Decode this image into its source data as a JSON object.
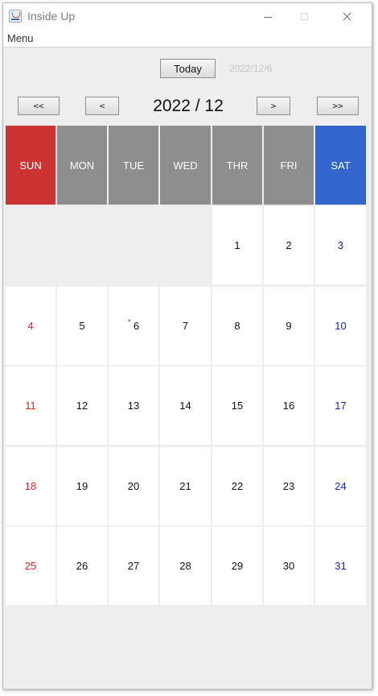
{
  "window": {
    "title": "Inside Up"
  },
  "menu": {
    "items": [
      "Menu"
    ]
  },
  "toolbar": {
    "today_label": "Today",
    "current_date": "2022/12/6"
  },
  "navigation": {
    "prev_year": "<<",
    "prev_month": "<",
    "month_label": "2022 / 12",
    "next_month": ">",
    "next_year": ">>"
  },
  "weekdays": [
    "SUN",
    "MON",
    "TUE",
    "WED",
    "THR",
    "FRI",
    "SAT"
  ],
  "calendar": {
    "weeks": [
      [
        "",
        "",
        "",
        "",
        "1",
        "2",
        "3"
      ],
      [
        "4",
        "5",
        "6",
        "7",
        "8",
        "9",
        "10"
      ],
      [
        "11",
        "12",
        "13",
        "14",
        "15",
        "16",
        "17"
      ],
      [
        "18",
        "19",
        "20",
        "21",
        "22",
        "23",
        "24"
      ],
      [
        "25",
        "26",
        "27",
        "28",
        "29",
        "30",
        "31"
      ]
    ],
    "event_marker": "*",
    "marked_day": "6"
  },
  "colors": {
    "sunday_header": "#cc3333",
    "saturday_header": "#3366cc",
    "weekday_header": "#8e8e8e",
    "sunday_text": "#dd2222",
    "saturday_text": "#1a22b8",
    "marker": "#1a8a1a"
  },
  "icons": {
    "app": "java-coffee-icon"
  }
}
